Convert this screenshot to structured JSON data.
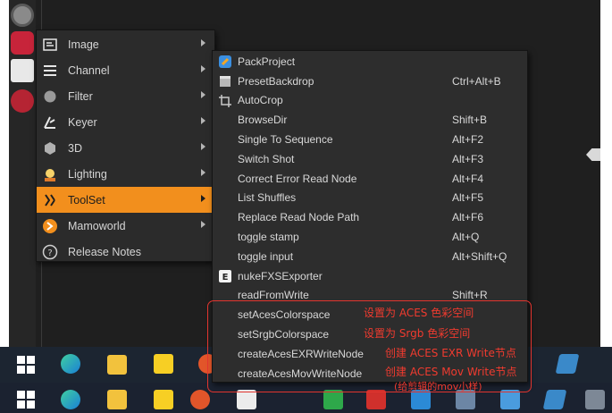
{
  "main_menu": {
    "items": [
      {
        "label": "Image",
        "icon": "image-icon",
        "has_submenu": true
      },
      {
        "label": "Channel",
        "icon": "channel-icon",
        "has_submenu": true
      },
      {
        "label": "Filter",
        "icon": "filter-icon",
        "has_submenu": true
      },
      {
        "label": "Keyer",
        "icon": "keyer-icon",
        "has_submenu": true
      },
      {
        "label": "3D",
        "icon": "3d-icon",
        "has_submenu": true
      },
      {
        "label": "Lighting",
        "icon": "lighting-icon",
        "has_submenu": true
      },
      {
        "label": "ToolSet",
        "icon": "toolset-icon",
        "has_submenu": true,
        "active": true
      },
      {
        "label": "Mamoworld",
        "icon": "mamoworld-icon",
        "has_submenu": true
      },
      {
        "label": "Release Notes",
        "icon": "help-icon",
        "has_submenu": false
      }
    ]
  },
  "submenu": {
    "items": [
      {
        "label": "PackProject",
        "shortcut": "",
        "icon": "pack-icon"
      },
      {
        "label": "PresetBackdrop",
        "shortcut": "Ctrl+Alt+B",
        "icon": "backdrop-icon"
      },
      {
        "label": "AutoCrop",
        "shortcut": "",
        "icon": "crop-icon"
      },
      {
        "label": "BrowseDir",
        "shortcut": "Shift+B"
      },
      {
        "label": "Single To Sequence",
        "shortcut": "Alt+F2"
      },
      {
        "label": "Switch Shot",
        "shortcut": "Alt+F3"
      },
      {
        "label": "Correct Error Read Node",
        "shortcut": "Alt+F4"
      },
      {
        "label": "List Shuffles",
        "shortcut": "Alt+F5"
      },
      {
        "label": "Replace Read Node Path",
        "shortcut": "Alt+F6"
      },
      {
        "label": "toggle stamp",
        "shortcut": "Alt+Q"
      },
      {
        "label": "toggle input",
        "shortcut": "Alt+Shift+Q"
      },
      {
        "label": "nukeFXSExporter",
        "shortcut": "",
        "icon": "exporter-icon"
      },
      {
        "label": "readFromWrite",
        "shortcut": "Shift+R"
      },
      {
        "label": "setAcesColorspace",
        "shortcut": ""
      },
      {
        "label": "setSrgbColorspace",
        "shortcut": ""
      },
      {
        "label": "createAcesEXRWriteNode",
        "shortcut": ""
      },
      {
        "label": "createAcesMovWriteNode",
        "shortcut": ""
      }
    ]
  },
  "annotations": {
    "set_aces": "设置为 ACES 色彩空间",
    "set_srgb": "设置为 Srgb 色彩空间",
    "create_exr": "创建 ACES EXR Write节点",
    "create_mov": "创建 ACES Mov Write节点",
    "mov_note": "(给剪辑的mov小样)"
  },
  "colors": {
    "menu_bg": "#2b2b2b",
    "active_item": "#f28f1d",
    "annotation_red": "#e2352f",
    "taskbar": "#1c2531"
  }
}
